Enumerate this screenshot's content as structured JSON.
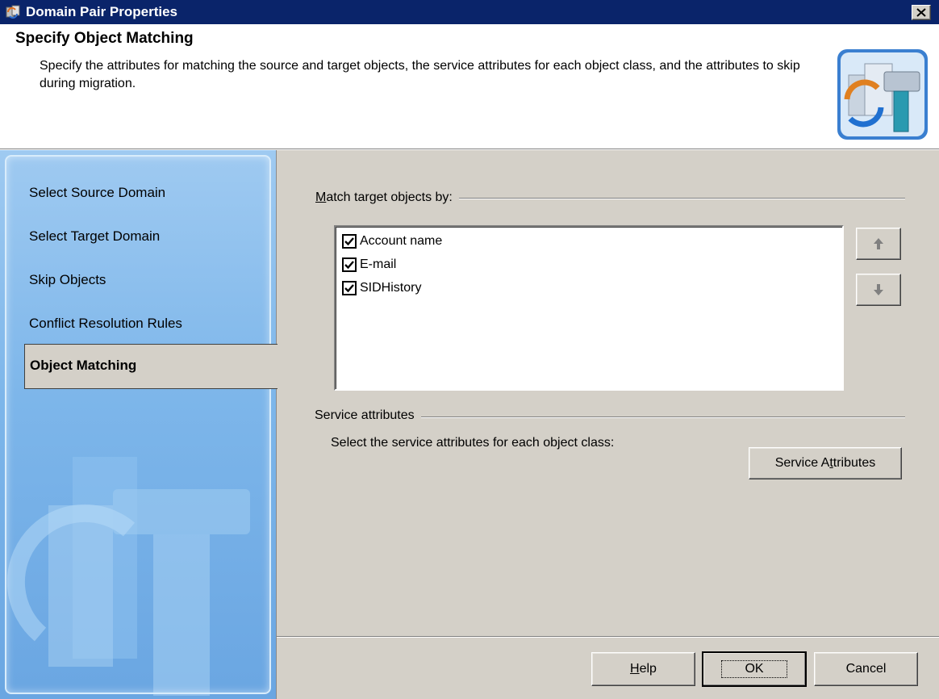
{
  "window": {
    "title": "Domain Pair Properties",
    "close_symbol": "✕"
  },
  "header": {
    "title": "Specify Object Matching",
    "description": "Specify the attributes for matching the source and target objects, the service attributes for each object class, and the attributes to skip during migration."
  },
  "nav": {
    "items": [
      {
        "label": "Select Source Domain"
      },
      {
        "label": "Select Target Domain"
      },
      {
        "label": "Skip Objects"
      },
      {
        "label": "Conflict Resolution Rules"
      },
      {
        "label": "Object Matching"
      }
    ],
    "active_index": 4
  },
  "match": {
    "label_first": "M",
    "label_rest": "atch target objects by:",
    "items": [
      {
        "label": "Account name",
        "checked": true
      },
      {
        "label": "E-mail",
        "checked": true
      },
      {
        "label": "SIDHistory",
        "checked": true
      }
    ],
    "up_icon": "arrow-up-icon",
    "down_icon": "arrow-down-icon"
  },
  "service": {
    "group_label": "Service attributes",
    "description": "Select the service attributes for each object class:",
    "button_pre": "Service A",
    "button_key": "t",
    "button_post": "tributes"
  },
  "buttons": {
    "help_key": "H",
    "help_rest": "elp",
    "ok": "OK",
    "cancel": "Cancel"
  },
  "colors": {
    "titlebar": "#0a246a",
    "dialog_face": "#d4d0c8",
    "sidebar_blue": "#7db6ea"
  }
}
